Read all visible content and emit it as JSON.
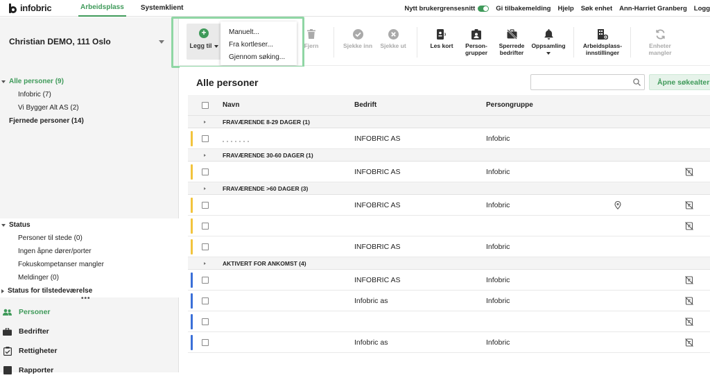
{
  "topbar": {
    "logo_text": "infobric",
    "tabs": [
      {
        "label": "Arbeidsplass",
        "active": true
      },
      {
        "label": "Systemklient",
        "active": false
      }
    ],
    "right": {
      "new_ui_label": "Nytt brukergrensesnitt",
      "feedback": "Gi tilbakemelding",
      "help": "Hjelp",
      "search_unit": "Søk enhet",
      "user": "Ann-Harriet Granberg",
      "logout": "Logg"
    }
  },
  "sidebar": {
    "site": "Christian DEMO, 111 Oslo",
    "tree": {
      "all": "Alle personer (9)",
      "children": [
        "Infobric (7)",
        "Vi Bygger Alt AS (2)"
      ],
      "removed": "Fjernede personer (14)"
    },
    "status": {
      "title": "Status",
      "items": [
        "Personer til stede (0)",
        "Ingen åpne dører/porter",
        "Fokuskompetanser mangler",
        "Meldinger (0)"
      ],
      "presence_title": "Status for tilstedeværelse"
    },
    "dots": "•••",
    "nav": [
      {
        "label": "Personer",
        "icon": "people-icon",
        "active": true
      },
      {
        "label": "Bedrifter",
        "icon": "briefcase-icon",
        "active": false
      },
      {
        "label": "Rettigheter",
        "icon": "clipboard-check-icon",
        "active": false
      },
      {
        "label": "Rapporter",
        "icon": "report-icon",
        "active": false
      }
    ]
  },
  "toolbar": {
    "add": "Legg til",
    "remove": "Fjern",
    "check_in": "Sjekke inn",
    "check_out": "Sjekke ut",
    "read_card": "Les kort",
    "person_groups": "Person-\ngrupper",
    "blocking_companies": "Sperrede\nbedrifter",
    "muster": "Oppsamling",
    "workplace_settings": "Arbeidsplass-\ninnstillinger",
    "missing_units": "Enheter\nmangler"
  },
  "add_menu": {
    "items": [
      "Manuelt...",
      "Fra kortleser...",
      "Gjennom søking..."
    ]
  },
  "main": {
    "title": "Alle personer",
    "search_placeholder": "",
    "open_search": "Åpne søkealternativer"
  },
  "table": {
    "columns": [
      "Navn",
      "Bedrift",
      "Persongruppe"
    ],
    "colors": {
      "absent": "#f2c43d",
      "activated": "#3b6fd8"
    },
    "groups": [
      {
        "label": "FRAVÆRENDE 8-29 DAGER (1)",
        "color": "absent",
        "rows": [
          {
            "name": "",
            "company": "INFOBRIC AS",
            "group": "Infobric",
            "pin": false,
            "badge": false,
            "redacted": true
          }
        ]
      },
      {
        "label": "FRAVÆRENDE 30-60 DAGER (1)",
        "color": "absent",
        "rows": [
          {
            "name": "",
            "company": "INFOBRIC AS",
            "group": "Infobric",
            "pin": false,
            "badge": true
          }
        ]
      },
      {
        "label": "FRAVÆRENDE >60 DAGER (3)",
        "color": "absent",
        "rows": [
          {
            "name": "",
            "company": "INFOBRIC AS",
            "group": "Infobric",
            "pin": true,
            "badge": true
          },
          {
            "name": "",
            "company": "",
            "group": "",
            "pin": false,
            "badge": true
          },
          {
            "name": "",
            "company": "INFOBRIC AS",
            "group": "Infobric",
            "pin": false,
            "badge": false
          }
        ]
      },
      {
        "label": "AKTIVERT FOR ANKOMST (4)",
        "color": "activated",
        "rows": [
          {
            "name": "",
            "company": "INFOBRIC AS",
            "group": "Infobric",
            "pin": false,
            "badge": true
          },
          {
            "name": "",
            "company": "Infobric as",
            "group": "Infobric",
            "pin": false,
            "badge": true
          },
          {
            "name": "",
            "company": "",
            "group": "",
            "pin": false,
            "badge": true
          },
          {
            "name": "",
            "company": "Infobric as",
            "group": "Infobric",
            "pin": false,
            "badge": true
          }
        ]
      }
    ]
  }
}
